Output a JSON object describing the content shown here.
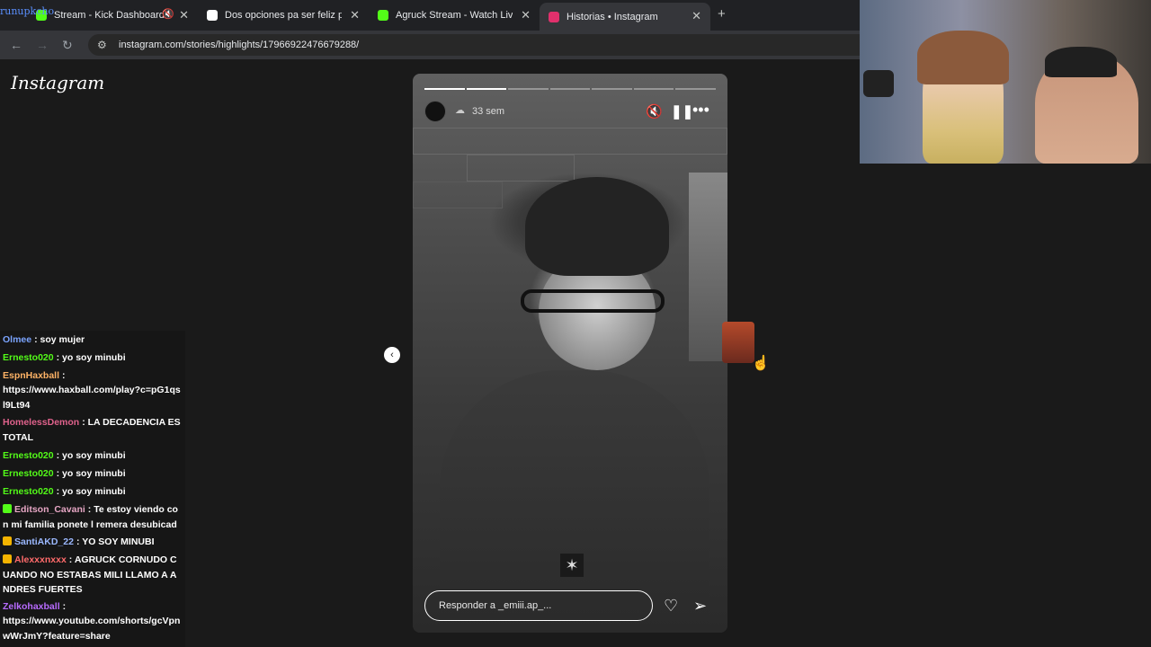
{
  "tabs": [
    {
      "label": "Stream - Kick Dashboard",
      "favicon_color": "#53fc18",
      "muted": true
    },
    {
      "label": "Dos opciones pa ser feliz para s",
      "favicon_color": "#ffffff"
    },
    {
      "label": "Agruck Stream - Watch Live or",
      "favicon_color": "#53fc18"
    },
    {
      "label": "Historias • Instagram",
      "favicon_color": "#e1306c",
      "active": true
    }
  ],
  "overlay_text": "runupkcho",
  "url": "instagram.com/stories/highlights/17966922476679288/",
  "instagram": {
    "logo": "Instagram",
    "story": {
      "time_ago": "33 sem",
      "progress_segments": 7,
      "progress_done": 2,
      "reply_placeholder": "Responder a _emiii.ap_..."
    }
  },
  "chat": [
    {
      "user": "Olmee",
      "color": "#7ba4ff",
      "text": "soy mujer"
    },
    {
      "user": "Ernesto020",
      "color": "#53fc18",
      "text": "yo soy minubi"
    },
    {
      "user": "EspnHaxball",
      "color": "#ffb366",
      "text": ""
    },
    {
      "user": "",
      "color": "#ffffff",
      "text": "https://www.haxball.com/play?c=pG1qsl9Lt94"
    },
    {
      "user": "HomelessDemon",
      "color": "#e0628c",
      "text": "LA DECADENCIA ES TOTAL"
    },
    {
      "user": "Ernesto020",
      "color": "#53fc18",
      "text": "yo soy minubi"
    },
    {
      "user": "Ernesto020",
      "color": "#53fc18",
      "text": "yo soy minubi"
    },
    {
      "user": "Ernesto020",
      "color": "#53fc18",
      "text": "yo soy minubi"
    },
    {
      "user": "Editson_Cavani",
      "color": "#e6a6c4",
      "badge_color": "#53fc18",
      "text": "Te estoy viendo con mi familia ponete l remera desubicado"
    },
    {
      "user": "SantiAKD_22",
      "color": "#9bb8ff",
      "badge_color": "#f5b400",
      "text": "YO SOY MINUBI"
    },
    {
      "user": "Alexxxnxxx",
      "color": "#ff6b6b",
      "badge_color": "#f5b400",
      "text": "AGRUCK CORNUDO CUANDO NO ESTABAS MILI LLAMO A ANDRES FUERTES"
    },
    {
      "user": "Zelkohaxball",
      "color": "#b86bff",
      "text": ""
    },
    {
      "user": "",
      "color": "#ffffff",
      "text": "https://www.youtube.com/shorts/gcVpnwWrJmY?feature=share"
    }
  ]
}
